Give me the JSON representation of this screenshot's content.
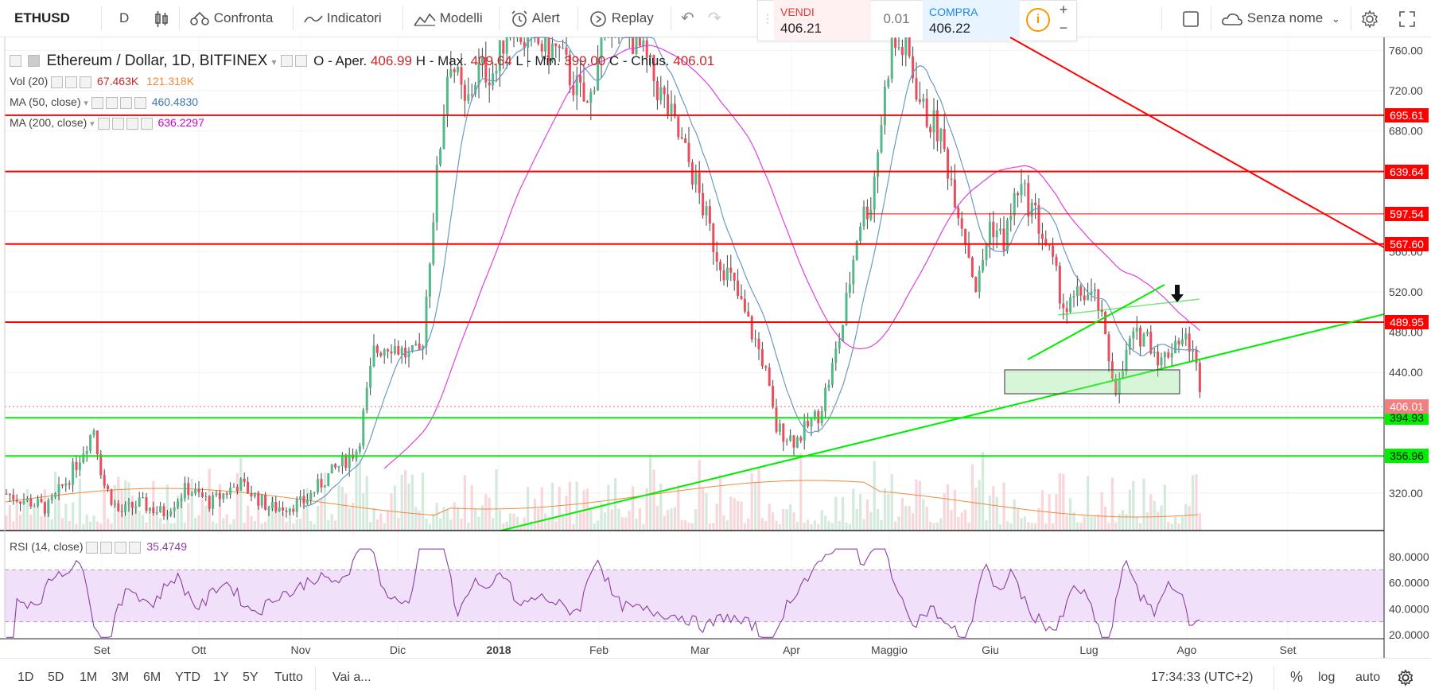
{
  "toolbar": {
    "symbol": "ETHUSD",
    "interval": "D",
    "compare": "Confronta",
    "indicators": "Indicatori",
    "templates": "Modelli",
    "alert": "Alert",
    "replay": "Replay",
    "layout_name": "Senza nome"
  },
  "trade": {
    "sell_label": "VENDI",
    "sell_price_big": "40",
    "sell_price_small": "6.21",
    "spread": "0.01",
    "buy_label": "COMPRA",
    "buy_price_big": "40",
    "buy_price_small": "6.22",
    "plus": "+",
    "minus": "−"
  },
  "legend": {
    "title": "Ethereum / Dollar, 1D, BITFINEX",
    "ohlc": {
      "o_label": "O - Aper.",
      "o": "406.99",
      "h_label": "H - Max.",
      "h": "409.64",
      "l_label": "L - Min.",
      "l": "399.00",
      "c_label": "C - Chius.",
      "c": "406.01"
    },
    "vol_label": "Vol (20)",
    "vol_value": "67.463K",
    "vol_ma": "121.318K",
    "ma50_label": "MA (50, close)",
    "ma50_value": "460.4830",
    "ma200_label": "MA (200, close)",
    "ma200_value": "636.2297",
    "rsi_label": "RSI (14, close)",
    "rsi_value": "35.4749"
  },
  "colors": {
    "up": "#53b987",
    "down": "#eb4d5c",
    "ma50": "#6a9ac4",
    "ma200": "#e040e0",
    "rsi": "#8a3fa0",
    "hline_red": "#ff0000",
    "hline_green": "#00ee00"
  },
  "chart_data": {
    "type": "candlestick",
    "symbol": "Ethereum / Dollar, 1D, BITFINEX",
    "x_tick_labels": [
      "Set",
      "Ott",
      "Nov",
      "Dic",
      "2018",
      "Feb",
      "Mar",
      "Apr",
      "Maggio",
      "Giu",
      "Lug",
      "Ago",
      "Set"
    ],
    "y_tick_labels": [
      "760.00",
      "720.00",
      "680.00",
      "640.00",
      "600.00",
      "560.00",
      "520.00",
      "480.00",
      "440.00",
      "400.00",
      "360.00",
      "320.00"
    ],
    "ylim": [
      282,
      775
    ],
    "last_close": 406.01,
    "horizontal_levels": [
      {
        "value": 695.61,
        "label": "695.61",
        "color": "red"
      },
      {
        "value": 639.64,
        "label": "639.64",
        "color": "red"
      },
      {
        "value": 597.54,
        "label": "597.54",
        "color": "red"
      },
      {
        "value": 567.6,
        "label": "567.60",
        "color": "red"
      },
      {
        "value": 489.95,
        "label": "489.95",
        "color": "red"
      },
      {
        "value": 394.93,
        "label": "394.93",
        "color": "green"
      },
      {
        "value": 356.96,
        "label": "356.96",
        "color": "green"
      }
    ],
    "rsi_ticks": [
      "80.0000",
      "60.0000",
      "40.0000",
      "20.0000"
    ],
    "rsi_band": [
      30,
      70
    ],
    "bottom_tools": {
      "ranges": [
        "1D",
        "5D",
        "1M",
        "3M",
        "6M",
        "YTD",
        "1Y",
        "5Y",
        "Tutto"
      ],
      "goto": "Vai a...",
      "time": "17:34:33 (UTC+2)",
      "percent": "%",
      "log": "log",
      "auto": "auto"
    }
  }
}
